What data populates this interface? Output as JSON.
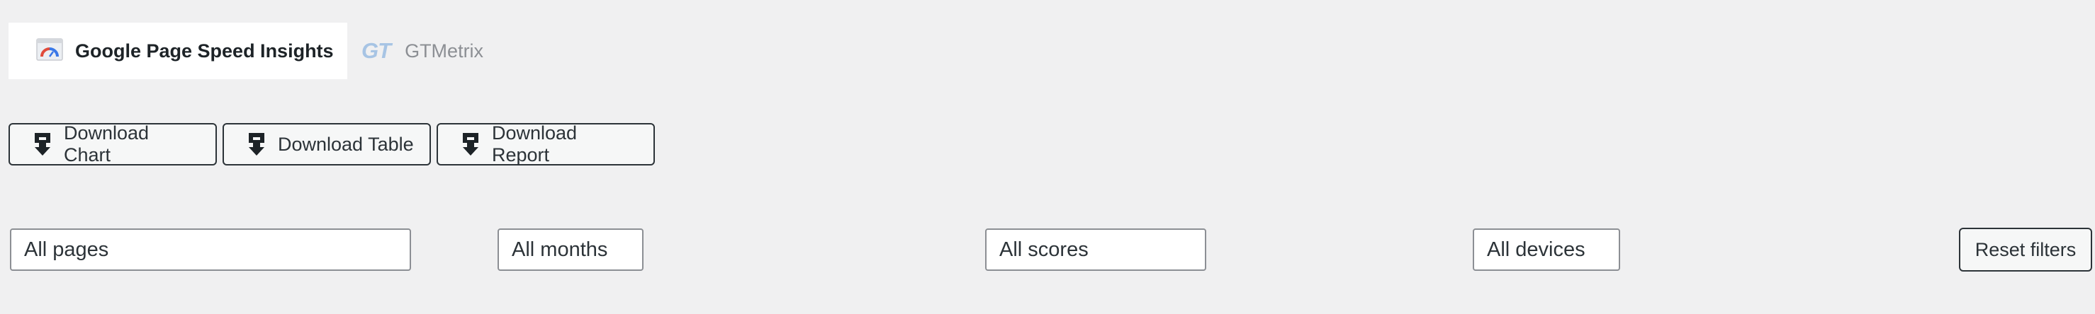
{
  "tabs": [
    {
      "label": "Google Page Speed Insights",
      "active": true,
      "icon": "pagespeed-gauge-icon"
    },
    {
      "label": "GTMetrix",
      "active": false,
      "icon": "gtmetrix-logo-icon",
      "logo_text": "GT"
    }
  ],
  "downloads": [
    {
      "label": "Download Chart",
      "icon": "download-icon"
    },
    {
      "label": "Download Table",
      "icon": "download-icon"
    },
    {
      "label": "Download Report",
      "icon": "download-icon"
    }
  ],
  "filters": {
    "pages": "All pages",
    "months": "All months",
    "scores": "All scores",
    "devices": "All devices",
    "reset_label": "Reset filters"
  },
  "colors": {
    "background": "#f0f0f1",
    "text": "#1d2327",
    "muted_text": "#8c8f94",
    "gt_logo": "#a7c4e4",
    "gauge_red": "#e04b3b",
    "gauge_blue": "#3b78e7"
  }
}
